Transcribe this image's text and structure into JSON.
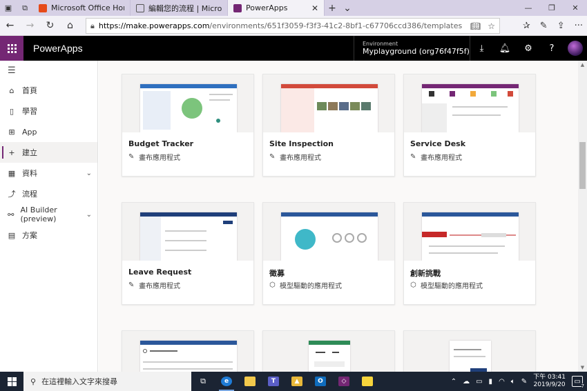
{
  "browser": {
    "tabs": [
      {
        "title": "Microsoft Office Home",
        "favicon_color": "#e64a19"
      },
      {
        "title": "編輯您的流程 | Microsoft Flo",
        "favicon_color": "#555555"
      },
      {
        "title": "PowerApps",
        "favicon_color": "#742774",
        "active": true
      }
    ],
    "url_host": "https://make.powerapps.com",
    "url_path": "/environments/651f3059-f3f3-41c2-8bf1-c67706ccd386/templates"
  },
  "app": {
    "brand": "PowerApps",
    "brand_color": "#742774",
    "environment_label": "Environment",
    "environment_name": "Myplayground (org76f47f5f)"
  },
  "nav": {
    "items": [
      {
        "label": "首頁",
        "icon": "home-icon"
      },
      {
        "label": "學習",
        "icon": "book-icon"
      },
      {
        "label": "App",
        "icon": "app-icon"
      },
      {
        "label": "建立",
        "icon": "plus-icon",
        "active": true
      },
      {
        "label": "資料",
        "icon": "grid-icon",
        "expandable": true
      },
      {
        "label": "流程",
        "icon": "flow-icon"
      },
      {
        "label": "AI Builder (preview)",
        "icon": "ai-builder-icon",
        "expandable": true
      },
      {
        "label": "方案",
        "icon": "solution-icon"
      }
    ]
  },
  "cards": [
    {
      "title": "Budget Tracker",
      "type": "畫布應用程式",
      "type_icon": "pencil-icon"
    },
    {
      "title": "Site Inspection",
      "type": "畫布應用程式",
      "type_icon": "pencil-icon"
    },
    {
      "title": "Service Desk",
      "type": "畫布應用程式",
      "type_icon": "pencil-icon"
    },
    {
      "title": "Leave Request",
      "type": "畫布應用程式",
      "type_icon": "pencil-icon"
    },
    {
      "title": "徵募",
      "type": "模型驅動的應用程式",
      "type_icon": "model-app-icon"
    },
    {
      "title": "創新挑戰",
      "type": "模型驅動的應用程式",
      "type_icon": "model-app-icon"
    }
  ],
  "taskbar": {
    "search_placeholder": "在這裡輸入文字來搜尋",
    "time": "下午 03:41",
    "date": "2019/9/20",
    "notification_count": "7"
  }
}
